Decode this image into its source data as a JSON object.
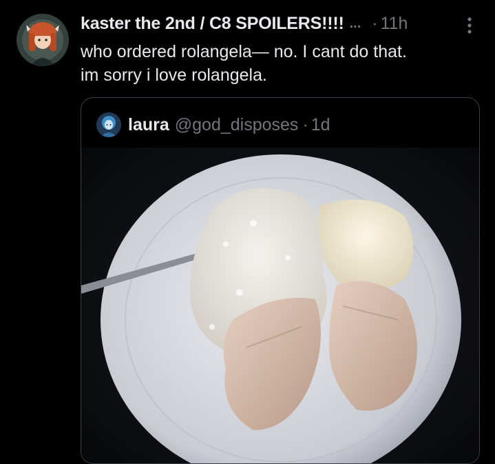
{
  "tweet": {
    "display_name": "kaster the 2nd / C8 SPOILERS!!!!",
    "truncation": "...",
    "separator": "·",
    "timestamp": "11h",
    "text_lines": [
      "who ordered rolangela— no. I cant do that.",
      "im sorry i love rolangela."
    ],
    "avatar_icon": "anime-character-avatar",
    "more_icon": "more-options-icon"
  },
  "quote": {
    "display_name": "laura",
    "handle": "@god_disposes",
    "separator": "·",
    "timestamp": "1d",
    "avatar_icon": "blue-character-avatar",
    "media_description_icon": "food-photo"
  },
  "colors": {
    "background": "#000000",
    "primary_text": "#e7e9ea",
    "secondary_text": "#71767b",
    "card_border": "#3a3f44"
  }
}
